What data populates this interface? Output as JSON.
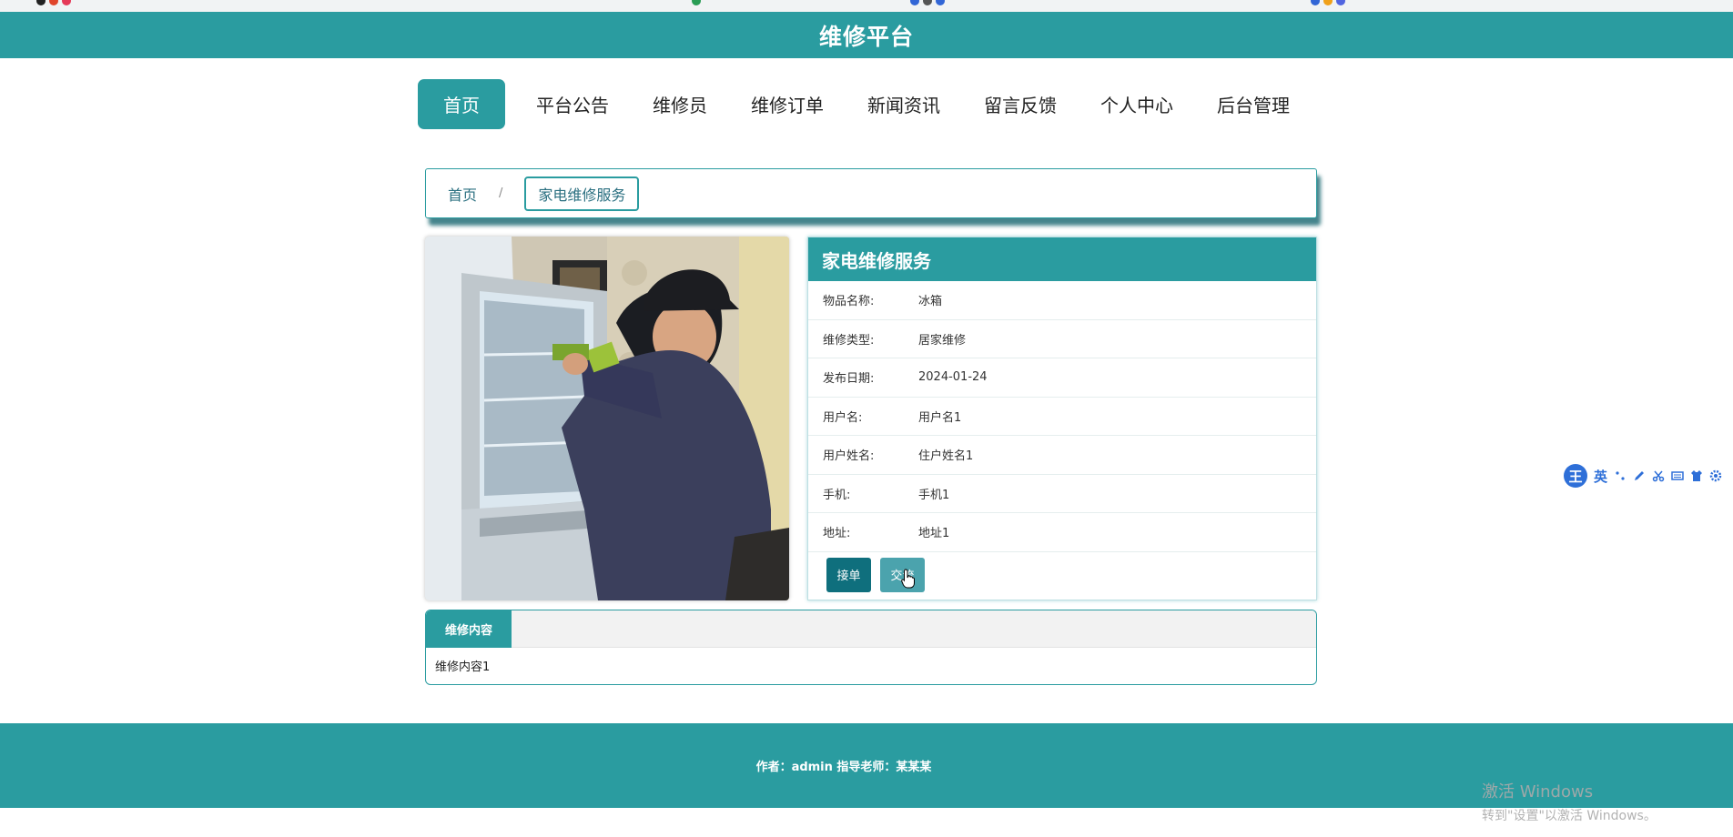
{
  "site": {
    "title": "维修平台"
  },
  "nav": [
    {
      "label": "首页",
      "active": true
    },
    {
      "label": "平台公告"
    },
    {
      "label": "维修员"
    },
    {
      "label": "维修订单"
    },
    {
      "label": "新闻资讯"
    },
    {
      "label": "留言反馈"
    },
    {
      "label": "个人中心"
    },
    {
      "label": "后台管理"
    }
  ],
  "breadcrumb": {
    "home": "首页",
    "separator": "/",
    "current": "家电维修服务"
  },
  "detail": {
    "title": "家电维修服务",
    "fields": [
      {
        "label": "物品名称:",
        "value": "冰箱"
      },
      {
        "label": "维修类型:",
        "value": "居家维修"
      },
      {
        "label": "发布日期:",
        "value": "2024-01-24"
      },
      {
        "label": "用户名:",
        "value": "用户名1"
      },
      {
        "label": "用户姓名:",
        "value": "住户姓名1"
      },
      {
        "label": "手机:",
        "value": "手机1"
      },
      {
        "label": "地址:",
        "value": "地址1"
      }
    ],
    "buttons": {
      "accept": "接单",
      "chat": "交流"
    }
  },
  "content_tab": {
    "label": "维修内容",
    "body": "维修内容1"
  },
  "footer": {
    "text": "作者：admin 指导老师：某某某"
  },
  "watermark": {
    "line1": "激活 Windows",
    "line2": "转到\"设置\"以激活 Windows。"
  },
  "ime": {
    "mode": "英"
  },
  "colors": {
    "primary": "#2a9ca0",
    "dark": "#0f6f7d",
    "footer": "#2a9ca0"
  }
}
